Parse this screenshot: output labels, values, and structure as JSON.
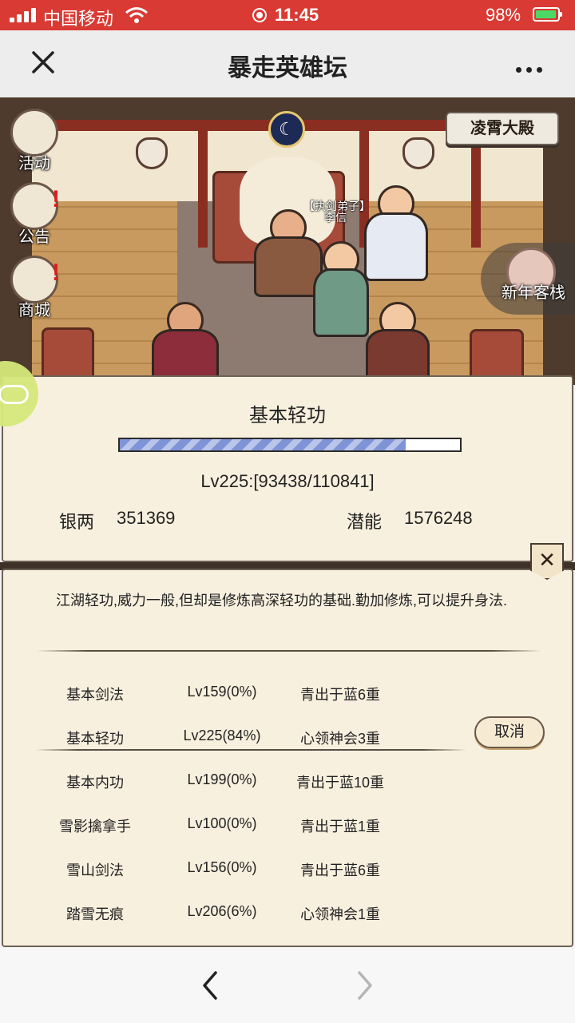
{
  "status_bar": {
    "carrier": "中国移动",
    "time": "11:45",
    "battery_percent": "98%",
    "battery_level": 0.98
  },
  "nav_bar": {
    "title": "暴走英雄坛"
  },
  "scene": {
    "location": "凌霄大殿",
    "npc_title": "【执剑弟子】",
    "npc_name": "李信",
    "side_buttons": [
      {
        "label": "活动"
      },
      {
        "label": "公告"
      },
      {
        "label": "商城"
      }
    ],
    "inn_label": "新年客栈"
  },
  "skill_panel": {
    "title": "基本轻功",
    "progress": 0.84,
    "level_text": "Lv225:[93438/110841]",
    "silver_label": "银两",
    "silver_value": "351369",
    "potential_label": "潜能",
    "potential_value": "1576248"
  },
  "detail_panel": {
    "description": "江湖轻功,威力一般,但却是修炼高深轻功的基础.勤加修炼,可以提升身法.",
    "close_symbol": "✕",
    "cancel_label": "取消",
    "skills": [
      {
        "name": "基本剑法",
        "level": "Lv159(0%)",
        "realm": "青出于蓝6重"
      },
      {
        "name": "基本轻功",
        "level": "Lv225(84%)",
        "realm": "心领神会3重"
      },
      {
        "name": "基本内功",
        "level": "Lv199(0%)",
        "realm": "青出于蓝10重"
      },
      {
        "name": "雪影擒拿手",
        "level": "Lv100(0%)",
        "realm": "青出于蓝1重"
      },
      {
        "name": "雪山剑法",
        "level": "Lv156(0%)",
        "realm": "青出于蓝6重"
      },
      {
        "name": "踏雪无痕",
        "level": "Lv206(6%)",
        "realm": "心领神会1重"
      }
    ]
  }
}
